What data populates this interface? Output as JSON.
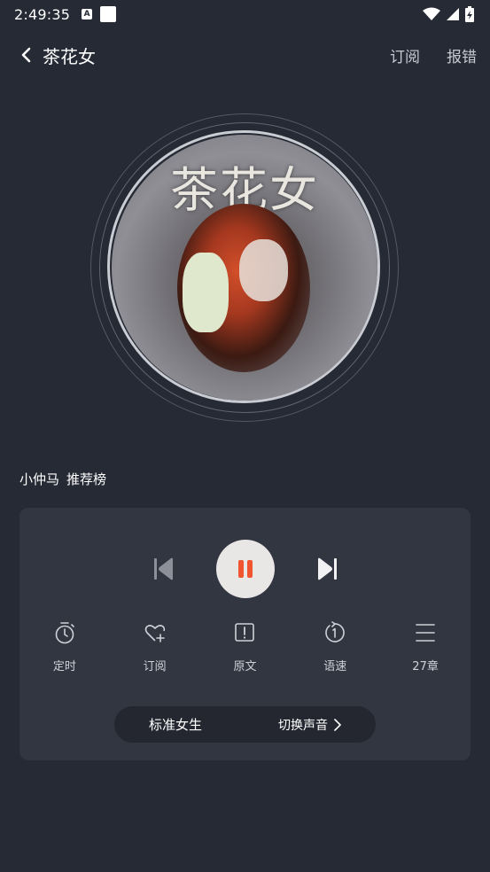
{
  "status_bar": {
    "time": "2:49:35",
    "a_badge": "A"
  },
  "header": {
    "title": "茶花女",
    "subscribe": "订阅",
    "report": "报错"
  },
  "cover": {
    "title_text": "茶花女"
  },
  "source": {
    "narrator": "小仲马",
    "list": "推荐榜"
  },
  "actions": [
    {
      "label": "定时",
      "icon": "timer-icon"
    },
    {
      "label": "订阅",
      "icon": "heart-plus-icon"
    },
    {
      "label": "原文",
      "icon": "book-icon"
    },
    {
      "label": "语速",
      "icon": "speed-icon"
    },
    {
      "label": "27章",
      "icon": "list-icon"
    }
  ],
  "voice": {
    "current": "标准女生",
    "switch_label": "切换声音"
  },
  "colors": {
    "background": "#262a35",
    "panel": "#323641",
    "accent": "#f0552f",
    "play_button": "#e9e6e6"
  }
}
